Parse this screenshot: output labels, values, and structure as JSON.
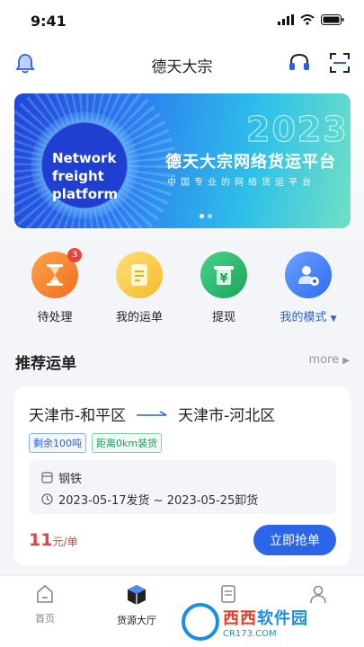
{
  "status": {
    "time": "9:41"
  },
  "header": {
    "title": "德天大宗"
  },
  "banner": {
    "en_line1": "Network",
    "en_line2": "freight",
    "en_line3": "platform",
    "year": "2023",
    "title": "德天大宗网络货运平台",
    "subtitle": "中国专业的网络货运平台"
  },
  "quick": [
    {
      "label": "待处理",
      "badge": "3",
      "icon": "hourglass-icon",
      "color": "#f58a2c"
    },
    {
      "label": "我的运单",
      "icon": "waybill-icon",
      "color": "#f5c53a"
    },
    {
      "label": "提现",
      "icon": "withdraw-icon",
      "color": "#2fb36a"
    },
    {
      "label": "我的模式",
      "icon": "user-settings-icon",
      "color": "#3b7bf0"
    }
  ],
  "section": {
    "title": "推荐运单",
    "more": "more"
  },
  "order": {
    "from": "天津市-和平区",
    "to": "天津市-河北区",
    "tag_remaining": "剩余100吨",
    "tag_distance": "距离0km装货",
    "cargo": "钢铁",
    "schedule": "2023-05-17发货 ~ 2023-05-25卸货",
    "price": "11",
    "price_unit": "元/单",
    "grab_label": "立即抢单"
  },
  "tabs": [
    {
      "label": "首页",
      "icon": "home-icon"
    },
    {
      "label": "货源大厅",
      "icon": "cargo-box-icon"
    },
    {
      "label": "",
      "icon": "document-icon"
    },
    {
      "label": "",
      "icon": "profile-icon"
    }
  ],
  "watermark": {
    "main_a": "西西",
    "main_b": "软件园",
    "url": "CR173.COM"
  }
}
